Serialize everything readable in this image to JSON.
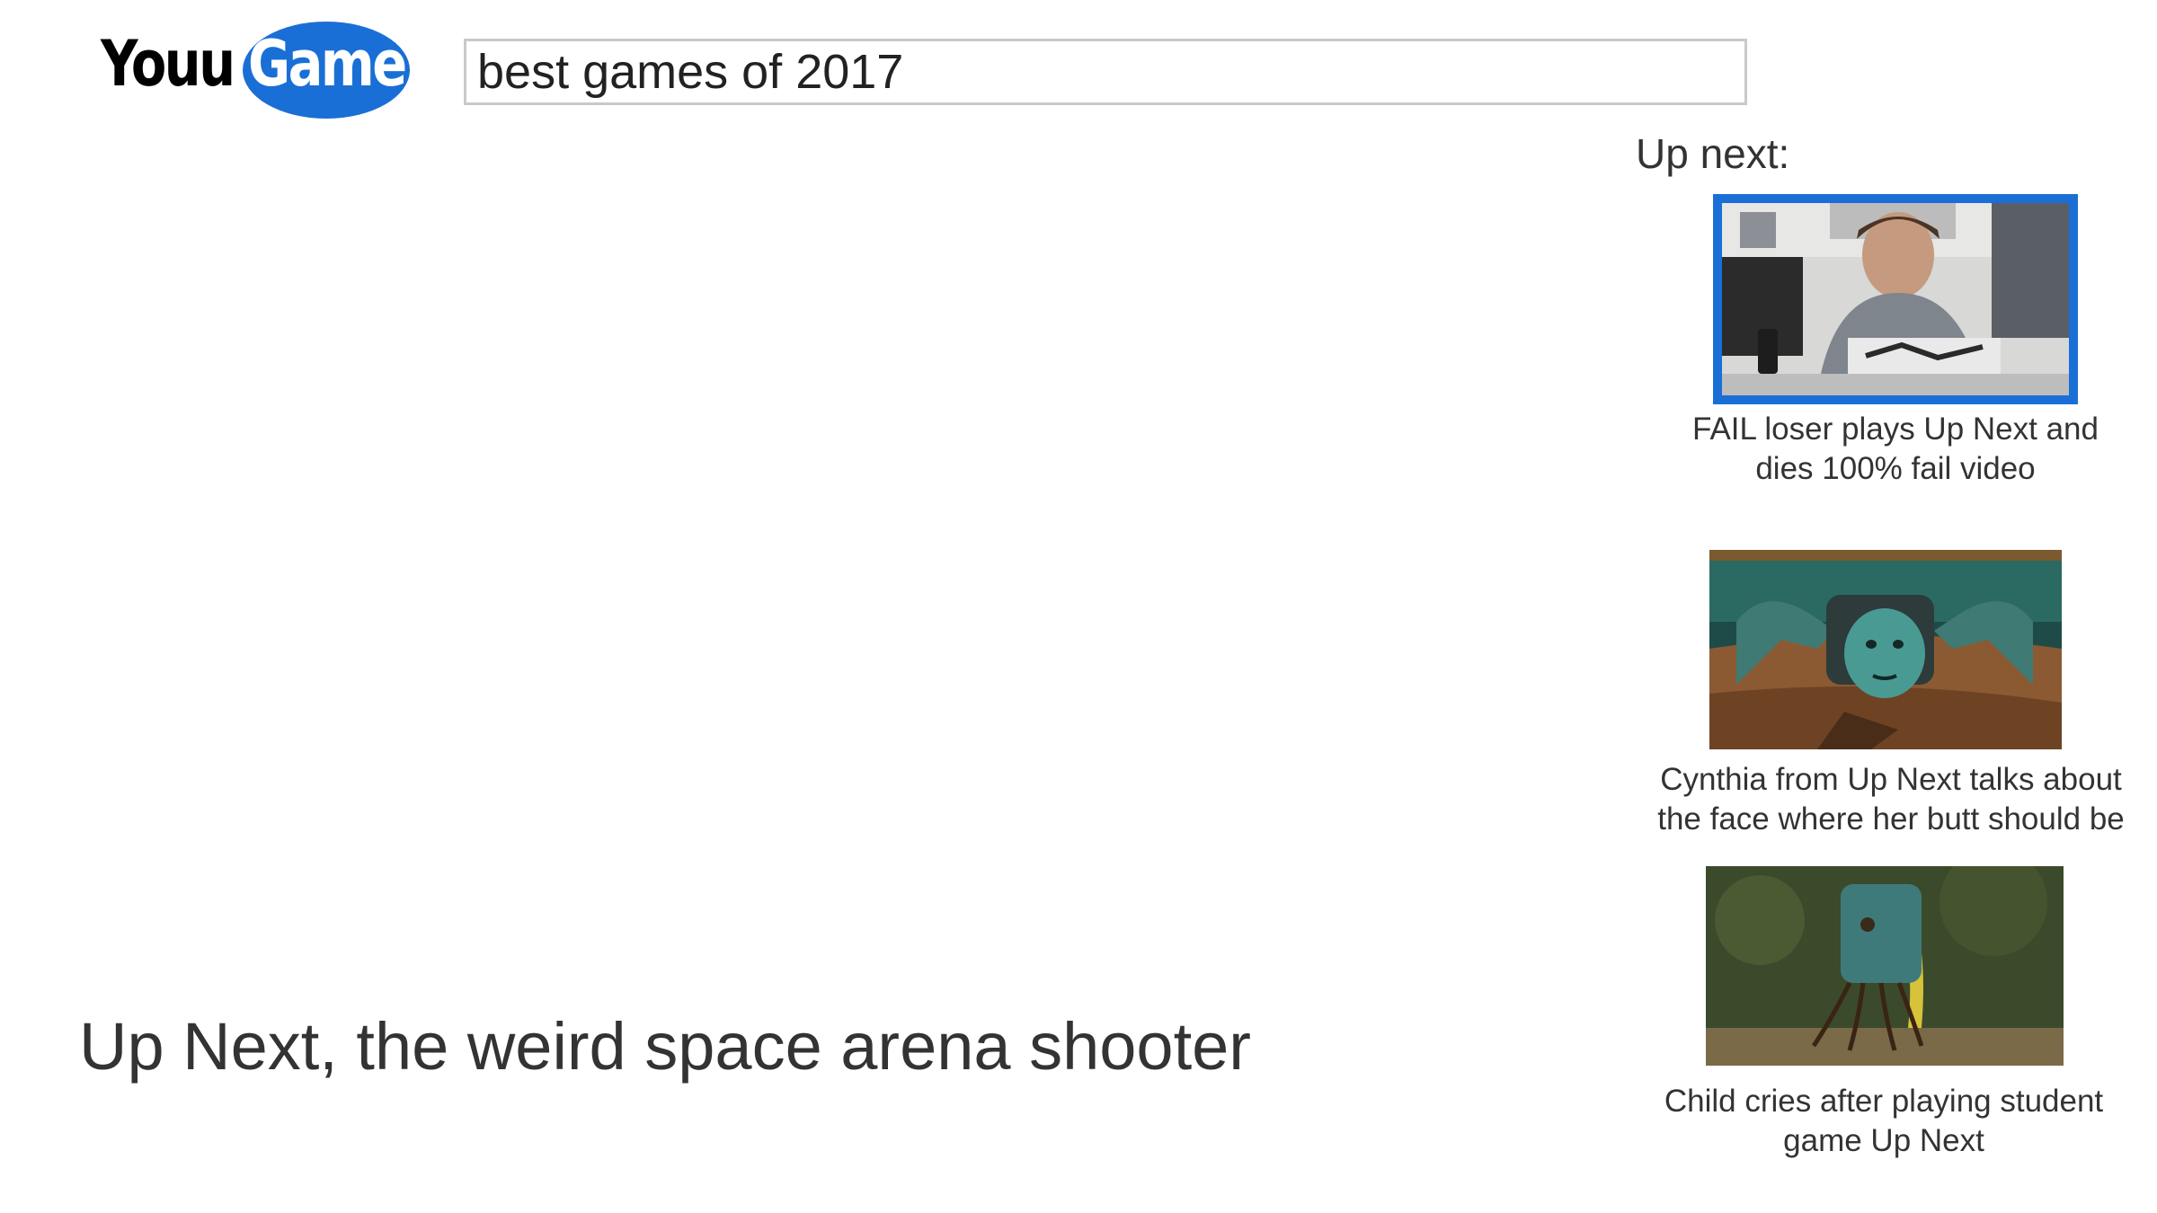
{
  "logo": {
    "prefix": "Youu",
    "suffix": "Game"
  },
  "search": {
    "value": "best games of 2017"
  },
  "video": {
    "title": "Up Next, the weird space arena shooter"
  },
  "up_next": {
    "heading": "Up next:",
    "items": [
      {
        "caption_line1": "FAIL loser plays Up Next and",
        "caption_line2": "dies 100% fail video",
        "selected": true
      },
      {
        "caption_line1": "Cynthia from Up Next talks about",
        "caption_line2": "the face where her butt should be",
        "selected": false
      },
      {
        "caption_line1": "Child cries after playing student",
        "caption_line2": "game Up Next",
        "selected": false
      }
    ]
  },
  "colors": {
    "accent": "#1a6fd6",
    "text": "#333333",
    "search_border": "#c9c9c9"
  }
}
